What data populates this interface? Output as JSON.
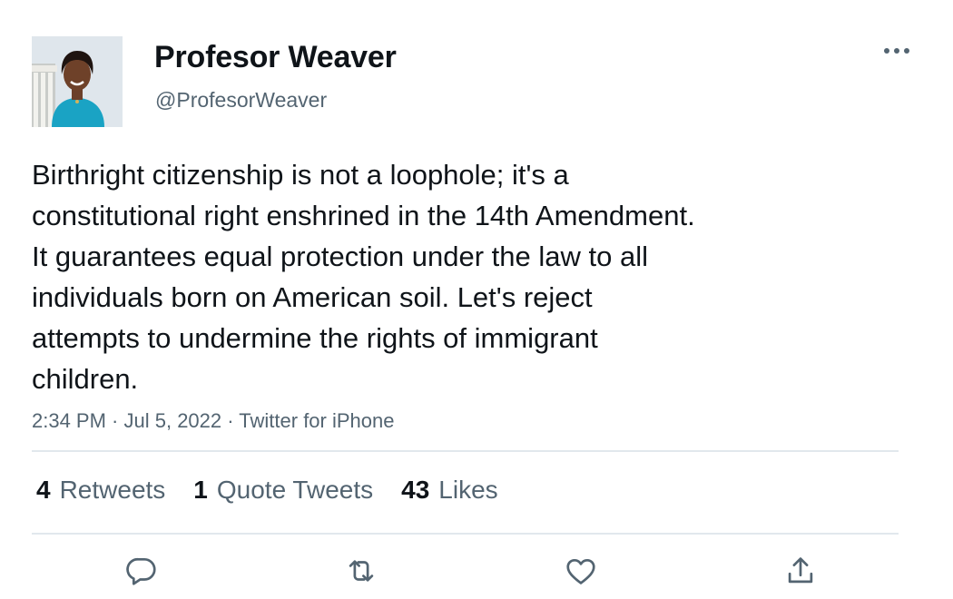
{
  "tweet": {
    "display_name": "Profesor Weaver",
    "handle": "@ProfesorWeaver",
    "text": "Birthright citizenship is not a loophole; it's a\nconstitutional right enshrined in the 14th Amendment.\nIt guarantees equal protection under the law to all\nindividuals born on American soil. Let's reject\nattempts to undermine the rights of immigrant\nchildren.",
    "time": "2:34 PM",
    "date": "Jul 5, 2022",
    "source": "Twitter for iPhone",
    "separator": " · "
  },
  "stats": {
    "retweets": {
      "count": "4",
      "label": "Retweets"
    },
    "quotes": {
      "count": "1",
      "label": "Quote Tweets"
    },
    "likes": {
      "count": "43",
      "label": "Likes"
    }
  },
  "icons": {
    "more": "more-horizontal-icon",
    "reply": "reply-icon",
    "retweet": "retweet-icon",
    "like": "heart-icon",
    "share": "share-icon"
  },
  "colors": {
    "text": "#0f1419",
    "secondary": "#536471",
    "divider": "#e1e8ed",
    "icon": "#536471"
  }
}
